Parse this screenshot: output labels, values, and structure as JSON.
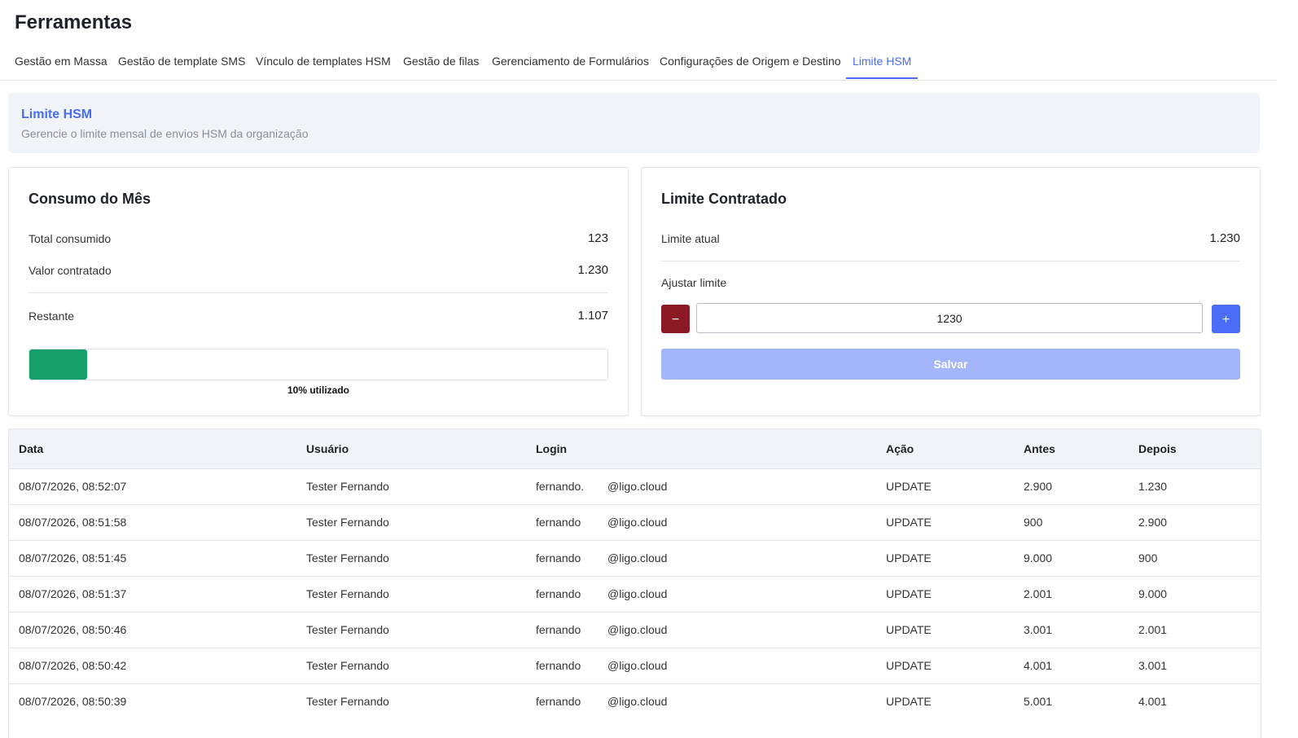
{
  "page": {
    "title": "Ferramentas"
  },
  "tabs": [
    {
      "label": "Gestão em Massa",
      "active": false
    },
    {
      "label": "Gestão de template SMS",
      "active": false
    },
    {
      "label": "Vínculo de templates HSM",
      "active": false
    },
    {
      "label": "Gestão de filas",
      "active": false
    },
    {
      "label": "Gerenciamento de Formulários",
      "active": false
    },
    {
      "label": "Configurações de Origem e Destino",
      "active": false
    },
    {
      "label": "Limite HSM",
      "active": true
    }
  ],
  "header": {
    "title": "Limite HSM",
    "subtitle": "Gerencie o limite mensal de envios HSM da organização"
  },
  "consumo": {
    "title": "Consumo do Mês",
    "total_label": "Total consumido",
    "total_value": "123",
    "contratado_label": "Valor contratado",
    "contratado_value": "1.230",
    "restante_label": "Restante",
    "restante_value": "1.107",
    "progress_percent": 10,
    "progress_label": "10% utilizado",
    "progress_color": "#16a06b"
  },
  "limite": {
    "title": "Limite Contratado",
    "atual_label": "Limite atual",
    "atual_value": "1.230",
    "ajustar_label": "Ajustar limite",
    "decrement_label": "−",
    "increment_label": "+",
    "input_value": "1230",
    "save_label": "Salvar"
  },
  "history": {
    "columns": [
      "Data",
      "Usuário",
      "Login",
      "Ação",
      "Antes",
      "Depois"
    ],
    "rows": [
      {
        "data": "08/07/2026, 08:52:07",
        "usuario": "Tester Fernando",
        "login_user": "fernando.",
        "login_domain": "@ligo.cloud",
        "acao": "UPDATE",
        "antes": "2.900",
        "depois": "1.230"
      },
      {
        "data": "08/07/2026, 08:51:58",
        "usuario": "Tester Fernando",
        "login_user": "fernando",
        "login_domain": "@ligo.cloud",
        "acao": "UPDATE",
        "antes": "900",
        "depois": "2.900"
      },
      {
        "data": "08/07/2026, 08:51:45",
        "usuario": "Tester Fernando",
        "login_user": "fernando",
        "login_domain": "@ligo.cloud",
        "acao": "UPDATE",
        "antes": "9.000",
        "depois": "900"
      },
      {
        "data": "08/07/2026, 08:51:37",
        "usuario": "Tester Fernando",
        "login_user": "fernando",
        "login_domain": "@ligo.cloud",
        "acao": "UPDATE",
        "antes": "2.001",
        "depois": "9.000"
      },
      {
        "data": "08/07/2026, 08:50:46",
        "usuario": "Tester Fernando",
        "login_user": "fernando",
        "login_domain": "@ligo.cloud",
        "acao": "UPDATE",
        "antes": "3.001",
        "depois": "2.001"
      },
      {
        "data": "08/07/2026, 08:50:42",
        "usuario": "Tester Fernando",
        "login_user": "fernando",
        "login_domain": "@ligo.cloud",
        "acao": "UPDATE",
        "antes": "4.001",
        "depois": "3.001"
      },
      {
        "data": "08/07/2026, 08:50:39",
        "usuario": "Tester Fernando",
        "login_user": "fernando",
        "login_domain": "@ligo.cloud",
        "acao": "UPDATE",
        "antes": "5.001",
        "depois": "4.001"
      }
    ]
  }
}
